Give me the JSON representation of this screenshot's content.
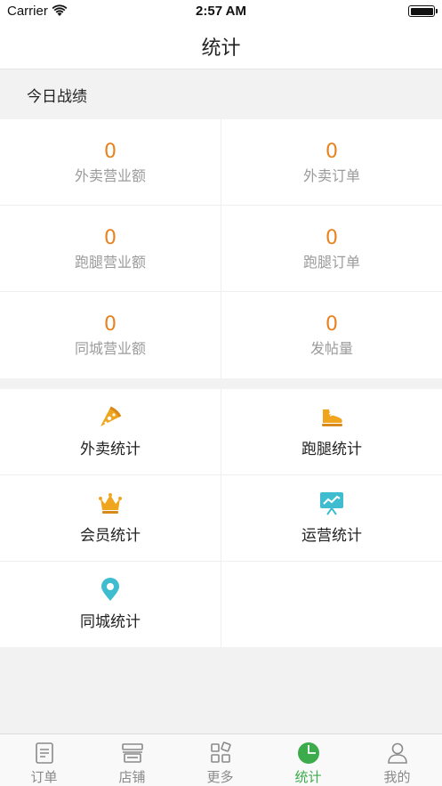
{
  "status_bar": {
    "carrier": "Carrier",
    "time": "2:57 AM"
  },
  "nav": {
    "title": "统计"
  },
  "section": {
    "title": "今日战绩"
  },
  "stats": [
    {
      "value": "0",
      "label": "外卖营业额"
    },
    {
      "value": "0",
      "label": "外卖订单"
    },
    {
      "value": "0",
      "label": "跑腿营业额"
    },
    {
      "value": "0",
      "label": "跑腿订单"
    },
    {
      "value": "0",
      "label": "同城营业额"
    },
    {
      "value": "0",
      "label": "发帖量"
    }
  ],
  "menu": [
    {
      "label": "外卖统计",
      "icon": "pizza-icon"
    },
    {
      "label": "跑腿统计",
      "icon": "shoe-icon"
    },
    {
      "label": "会员统计",
      "icon": "crown-icon"
    },
    {
      "label": "运营统计",
      "icon": "presentation-chart-icon"
    },
    {
      "label": "同城统计",
      "icon": "location-pin-icon"
    }
  ],
  "tabs": [
    {
      "label": "订单",
      "icon": "document-icon"
    },
    {
      "label": "店铺",
      "icon": "store-icon"
    },
    {
      "label": "更多",
      "icon": "grid-icon"
    },
    {
      "label": "统计",
      "icon": "pie-chart-icon",
      "active": true
    },
    {
      "label": "我的",
      "icon": "person-icon"
    }
  ],
  "colors": {
    "accent_orange": "#e8821f",
    "active_green": "#3cab4b",
    "icon_gold": "#f0a51e",
    "icon_teal": "#3fbcd0"
  }
}
